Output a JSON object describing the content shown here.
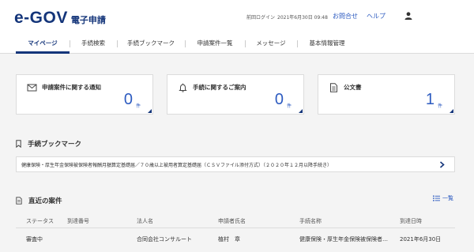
{
  "header": {
    "logo_mark": "e-GOV",
    "logo_sub": "電子申請",
    "last_login_label": "前回ログイン",
    "last_login_time": "2021年6月30日 09:48",
    "contact_link": "お問合せ",
    "help_link": "ヘルプ"
  },
  "nav": {
    "items": [
      {
        "label": "マイページ"
      },
      {
        "label": "手続検索"
      },
      {
        "label": "手続ブックマーク"
      },
      {
        "label": "申請案件一覧"
      },
      {
        "label": "メッセージ"
      },
      {
        "label": "基本情報管理"
      }
    ]
  },
  "cards": [
    {
      "title": "申請案件に関する通知",
      "count": "0",
      "unit": "件",
      "icon": "mail-icon"
    },
    {
      "title": "手続に関するご案内",
      "count": "0",
      "unit": "件",
      "icon": "bell-icon"
    },
    {
      "title": "公文書",
      "count": "1",
      "unit": "件",
      "icon": "document-icon"
    }
  ],
  "bookmarks": {
    "title": "手続ブックマーク",
    "items": [
      {
        "label": "健康保険・厚生年金保険被保険者報酬月額算定基礎届／７０歳以上被用者算定基礎届（ＣＳＶファイル添付方式）（２０２０年１２月以降手続き）"
      }
    ]
  },
  "recent": {
    "title": "直近の案件",
    "list_link": "一覧",
    "columns": [
      "ステータス",
      "到達番号",
      "法人名",
      "申請者氏名",
      "手続名称",
      "到達日時"
    ],
    "rows": [
      {
        "status": "審査中",
        "arrival_no": "",
        "corp": "合同会社コンサルート",
        "applicant": "植村　章",
        "procedure": "健康保険・厚生年金保険被保険者…",
        "date": "2021年6月30日"
      }
    ]
  },
  "colors": {
    "brand": "#14357a",
    "link": "#2d5bc0",
    "background": "#f4f4f4"
  }
}
